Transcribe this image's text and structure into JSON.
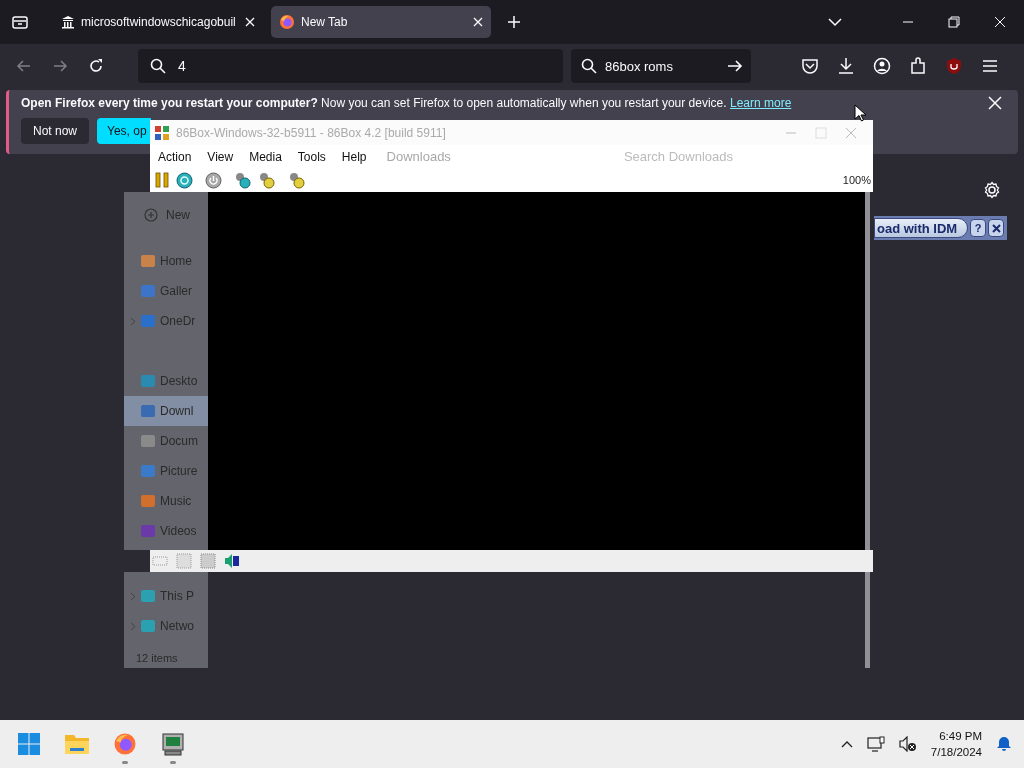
{
  "browser": {
    "tabs": [
      {
        "title": "microsoftwindowschicagobuil",
        "selected": false
      },
      {
        "title": "New Tab",
        "selected": true
      }
    ],
    "nav": {
      "back_disabled": true,
      "forward_disabled": true
    },
    "url_bar": {
      "value": "4"
    },
    "search_bar": {
      "value": "86box roms"
    },
    "notification": {
      "text": "**Open Firefox every time you restart your computer?** Now you can set Firefox to open automatically when you restart your device.",
      "link": "Learn more",
      "buttons": [
        "Not now",
        "Yes, op"
      ]
    },
    "idm_bar": {
      "label": "oad with IDM",
      "help": "?"
    }
  },
  "explorer": {
    "address": "Downloads",
    "search_placeholder": "Search Downloads",
    "new_button": "New",
    "sidebar": [
      {
        "label": "Home",
        "selected": false,
        "expander": false
      },
      {
        "label": "Galler",
        "selected": false,
        "expander": false
      },
      {
        "label": "OneDr",
        "selected": false,
        "expander": true
      },
      {
        "label": "Deskto",
        "selected": false,
        "expander": false
      },
      {
        "label": "Downl",
        "selected": true,
        "expander": false
      },
      {
        "label": "Docum",
        "selected": false,
        "expander": false
      },
      {
        "label": "Picture",
        "selected": false,
        "expander": false
      },
      {
        "label": "Music",
        "selected": false,
        "expander": false
      },
      {
        "label": "Videos",
        "selected": false,
        "expander": false
      }
    ],
    "sidebar_bottom": [
      {
        "label": "This P",
        "selected": false,
        "expander": true
      },
      {
        "label": "Netwo",
        "selected": false,
        "expander": true
      }
    ],
    "status": "12 items"
  },
  "emulator": {
    "title": "86Box-Windows-32-b5911 - 86Box 4.2 [build 5911]",
    "menu": [
      "Action",
      "View",
      "Media",
      "Tools",
      "Help"
    ],
    "zoom": "100%"
  },
  "taskbar": {
    "apps": [
      {
        "running": false
      },
      {
        "running": false
      },
      {
        "running": true
      },
      {
        "running": true
      }
    ],
    "time": "6:49 PM",
    "date": "7/18/2024"
  }
}
